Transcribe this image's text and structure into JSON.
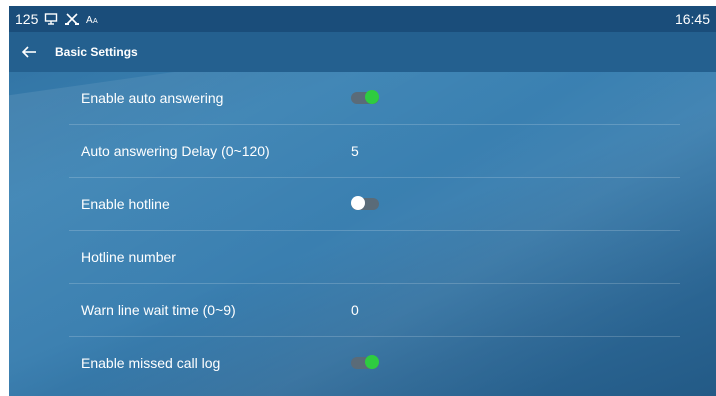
{
  "status_bar": {
    "extension": "125",
    "icons": [
      "screen-share-icon",
      "network-icon",
      "font-size-icon"
    ],
    "time": "16:45"
  },
  "header": {
    "back_icon": "arrow-left-icon",
    "title": "Basic Settings"
  },
  "settings": [
    {
      "label": "Enable auto answering",
      "type": "toggle",
      "on": true
    },
    {
      "label": "Auto answering Delay (0~120)",
      "type": "value",
      "value": "5"
    },
    {
      "label": "Enable hotline",
      "type": "toggle",
      "on": false
    },
    {
      "label": "Hotline number",
      "type": "value",
      "value": ""
    },
    {
      "label": "Warn line wait time (0~9)",
      "type": "value",
      "value": "0"
    },
    {
      "label": "Enable missed call log",
      "type": "toggle",
      "on": true
    }
  ],
  "colors": {
    "toggle_on": "#2ecc40",
    "toggle_off_knob": "#ffffff",
    "status_bar_bg": "#1a4d7a",
    "header_bg": "#24608f"
  }
}
